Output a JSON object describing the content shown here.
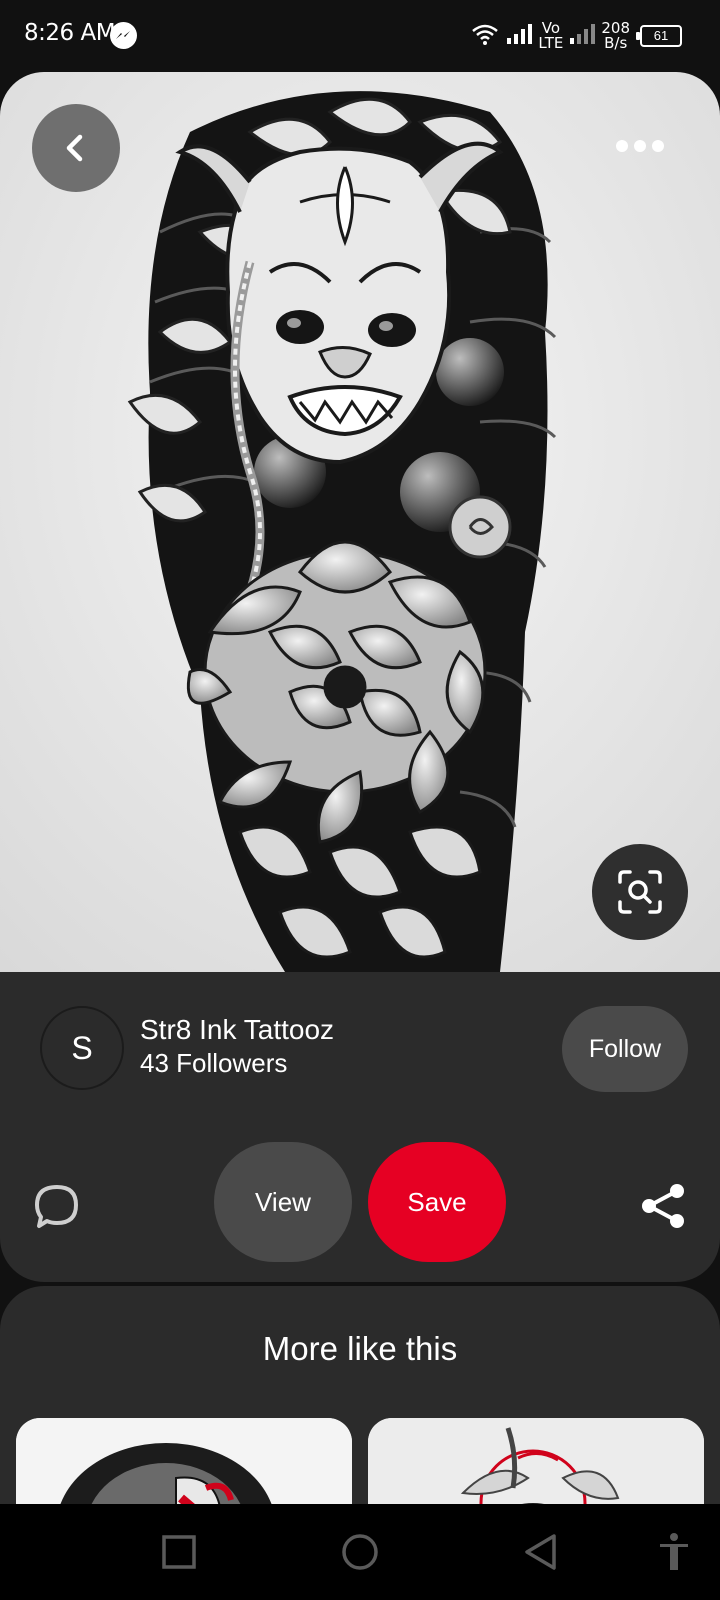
{
  "status_bar": {
    "time": "8:26 AM",
    "network_top": "Vo",
    "network_bottom": "LTE",
    "speed_value": "208",
    "speed_unit": "B/s",
    "battery": "61"
  },
  "pin": {
    "image_icon": "oni-mask-chrysanthemum-tattoo-illustration",
    "back_icon": "chevron-left-icon",
    "more_icon": "more-horizontal-icon",
    "lens_icon": "visual-search-icon"
  },
  "creator": {
    "avatar_initial": "S",
    "name": "Str8 Ink Tattooz",
    "followers": "43 Followers",
    "follow_label": "Follow"
  },
  "actions": {
    "comment_icon": "comment-icon",
    "view_label": "View",
    "save_label": "Save",
    "share_icon": "share-icon"
  },
  "more_like_this": {
    "title": "More like this"
  },
  "nav_bar": {
    "recents_icon": "square-icon",
    "home_icon": "circle-icon",
    "back_icon": "triangle-back-icon",
    "accessibility_icon": "accessibility-icon"
  },
  "colors": {
    "save_red": "#e60023",
    "card_bg": "#2b2b2b",
    "button_gray": "#4a4a4a"
  }
}
